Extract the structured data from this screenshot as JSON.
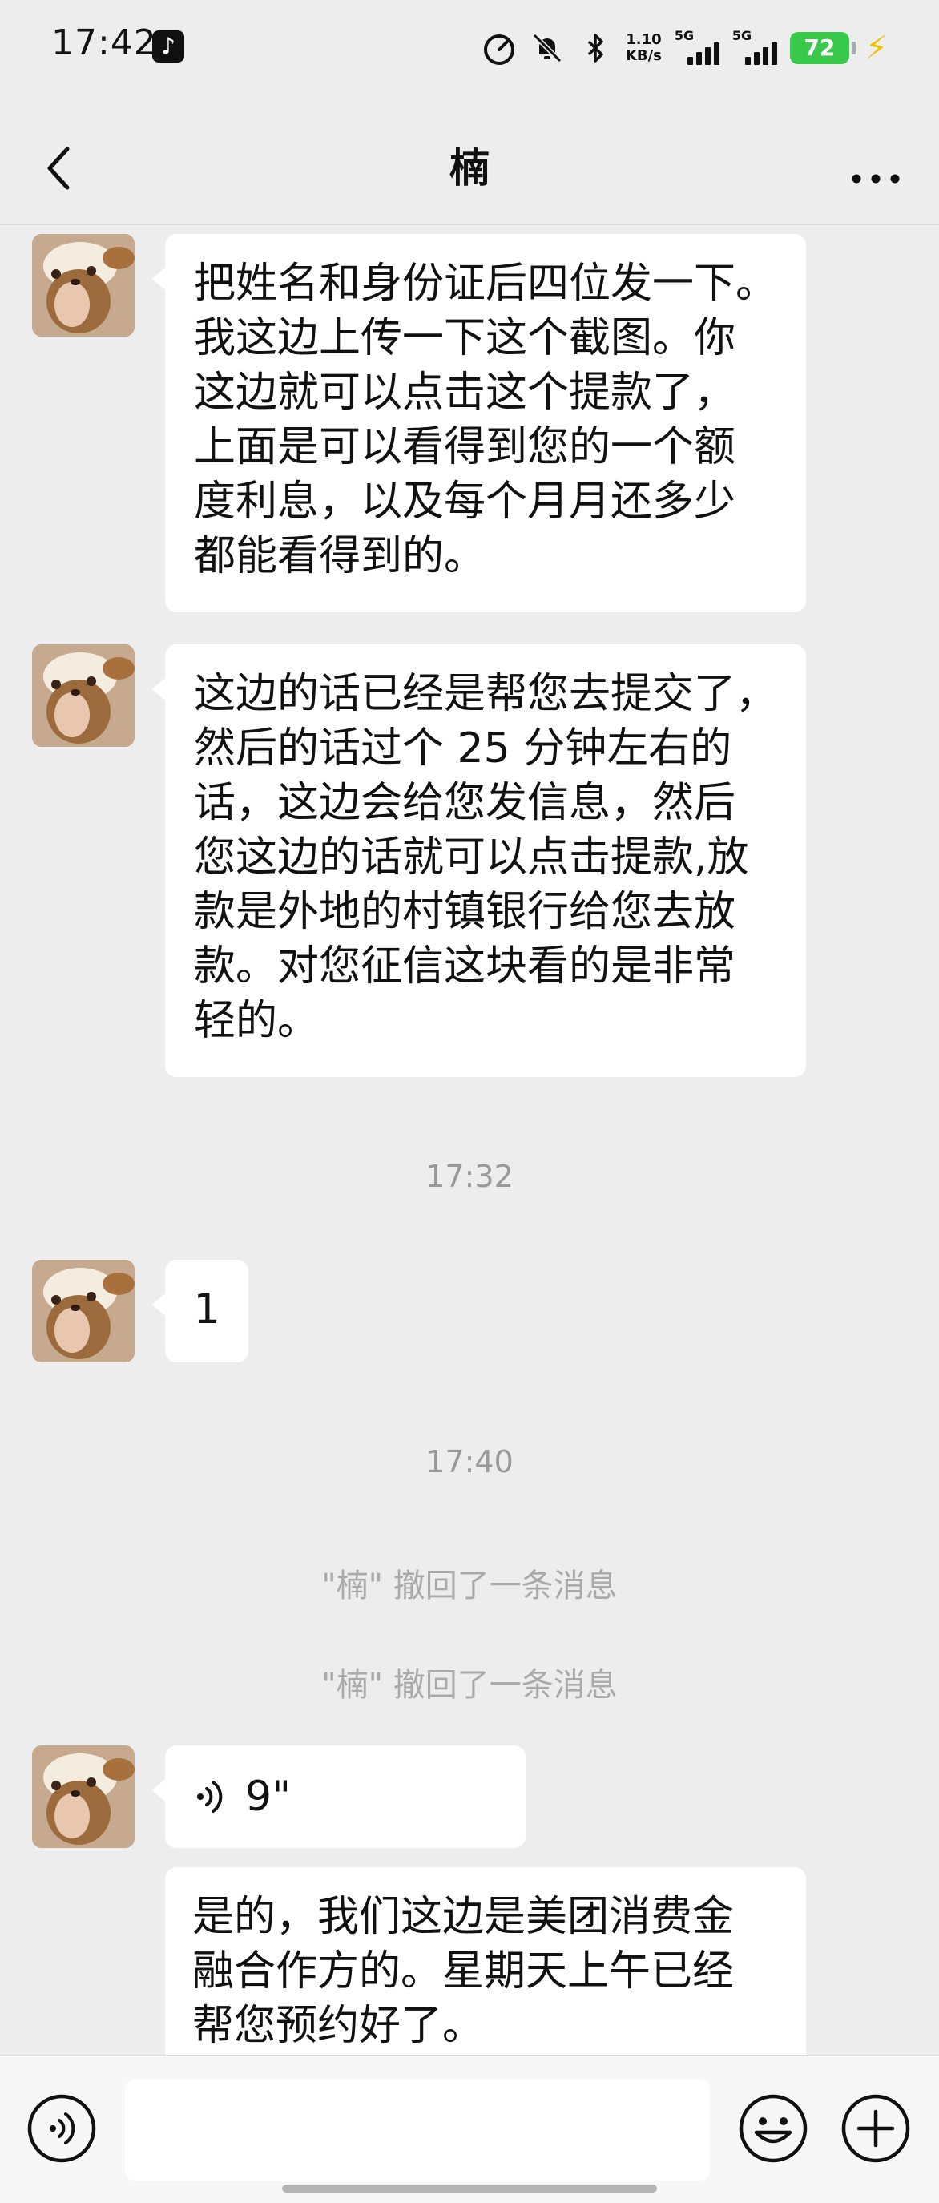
{
  "status_bar": {
    "time": "17:42",
    "net_speed_value": "1.10",
    "net_speed_unit": "KB/s",
    "sig1_label": "5G",
    "sig2_label": "5G",
    "battery": "72"
  },
  "header": {
    "title": "楠"
  },
  "messages": [
    {
      "type": "text",
      "lines": [
        "把姓名和身份证后四位发一下。",
        "我这边上传一下这个截图。你",
        "这边就可以点击这个提款了，",
        "上面是可以看得到您的一个额",
        "度利息，以及每个月月还多少",
        "都能看得到的。"
      ]
    },
    {
      "type": "text",
      "lines": [
        "这边的话已经是帮您去提交了，",
        "然后的话过个 25 分钟左右的",
        "话，这边会给您发信息，然后",
        "您这边的话就可以点击提款,放",
        "款是外地的村镇银行给您去放",
        "款。对您征信这块看的是非常",
        "轻的。"
      ]
    },
    {
      "type": "time",
      "text": "17:32"
    },
    {
      "type": "text",
      "lines": [
        "1"
      ]
    },
    {
      "type": "time",
      "text": "17:40"
    },
    {
      "type": "recall",
      "text": "\"楠\" 撤回了一条消息"
    },
    {
      "type": "recall",
      "text": "\"楠\" 撤回了一条消息"
    },
    {
      "type": "voice",
      "duration": "9\""
    },
    {
      "type": "text",
      "lines": [
        "是的，我们这边是美团消费金",
        "融合作方的。星期天上午已经",
        "帮您预约好了。"
      ]
    }
  ],
  "input_bar": {
    "placeholder": ""
  },
  "colors": {
    "background": "#ededed",
    "bubble": "#ffffff",
    "battery": "#38c84a",
    "charging": "#f2c200"
  }
}
